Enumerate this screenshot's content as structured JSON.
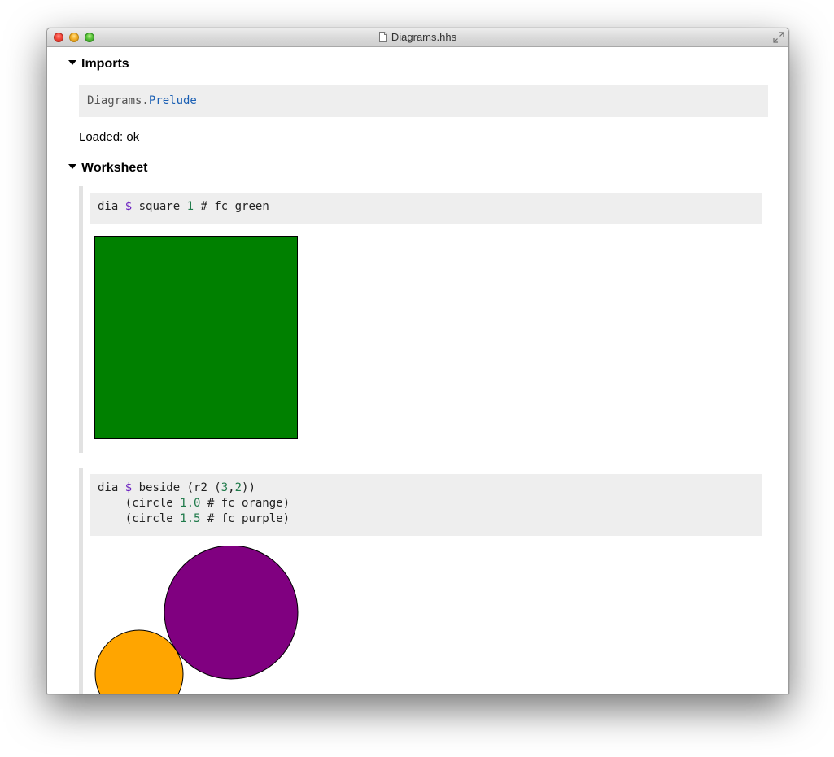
{
  "window": {
    "title": "Diagrams.hhs"
  },
  "imports": {
    "header": "Imports",
    "code": {
      "module": "Diagrams.",
      "name": "Prelude"
    },
    "status": "Loaded: ok"
  },
  "worksheet": {
    "header": "Worksheet",
    "cells": [
      {
        "code_line1": {
          "t1": "dia ",
          "op": "$",
          "t2": " square ",
          "n1": "1",
          "t3": " # fc green"
        },
        "output": {
          "shape": "square",
          "fill": "#008000"
        }
      },
      {
        "code_line1": {
          "t1": "dia ",
          "op": "$",
          "t2": " beside (r2 (",
          "n1": "3",
          "t3": ",",
          "n2": "2",
          "t4": "))"
        },
        "code_line2": {
          "t1": "    (circle ",
          "n1": "1.0",
          "t2": " # fc orange)"
        },
        "code_line3": {
          "t1": "    (circle ",
          "n1": "1.5",
          "t2": " # fc purple)"
        },
        "output": {
          "shapes": [
            "circle",
            "circle"
          ],
          "fills": [
            "#ffa500",
            "#800080"
          ]
        }
      }
    ]
  }
}
